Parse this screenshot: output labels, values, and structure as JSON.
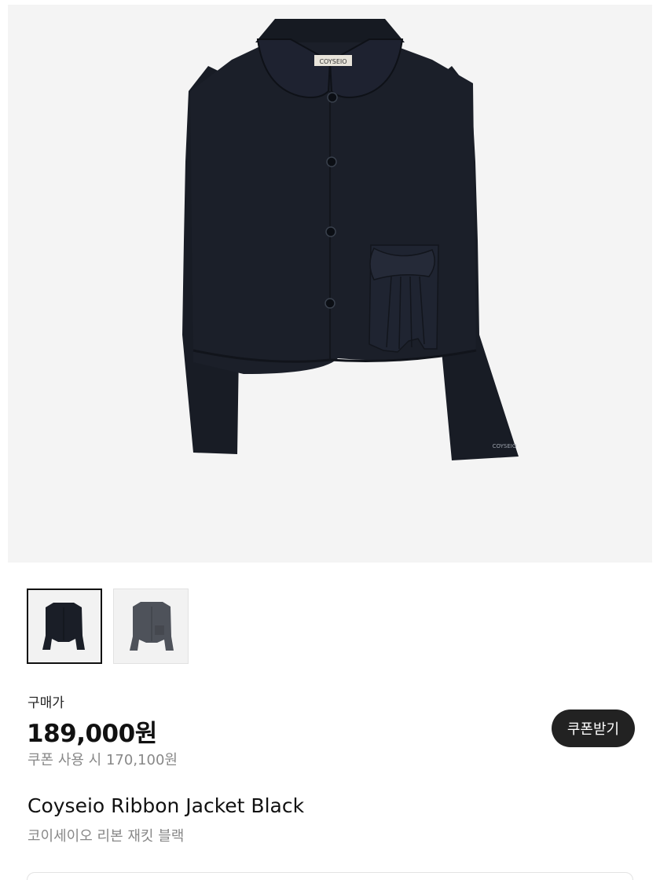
{
  "product_image": {
    "brand_label": "COYSEIO",
    "sleeve_label": "COYSEIO"
  },
  "thumbnails": [
    {
      "name": "black",
      "color": "#1a1e27",
      "selected": true
    },
    {
      "name": "gray",
      "color": "#4e525a",
      "selected": false
    }
  ],
  "price": {
    "label": "구매가",
    "amount": "189,000원",
    "coupon_note": "쿠폰 사용 시 170,100원"
  },
  "coupon_button": {
    "label": "쿠폰받기"
  },
  "product": {
    "name": "Coyseio Ribbon Jacket Black",
    "name_ko": "코이세이오 리본 재킷 블랙"
  }
}
